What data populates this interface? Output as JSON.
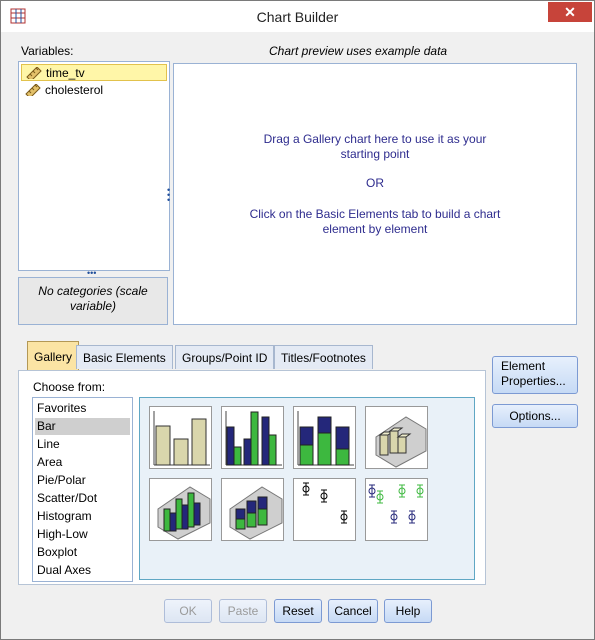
{
  "window": {
    "title": "Chart Builder",
    "close_label": "✕"
  },
  "variables": {
    "label": "Variables:",
    "items": [
      {
        "label": "time_tv",
        "icon": "scale-ruler-icon"
      },
      {
        "label": "cholesterol",
        "icon": "scale-ruler-icon"
      }
    ],
    "no_categories_line1": "No categories (scale",
    "no_categories_line2": "variable)"
  },
  "preview": {
    "caption": "Chart preview uses example data",
    "line1": "Drag a Gallery chart here to use it as your",
    "line2": "starting point",
    "or": "OR",
    "line3": "Click on the Basic Elements tab to build a chart",
    "line4": "element by element"
  },
  "tabs": [
    {
      "label": "Gallery",
      "active": true
    },
    {
      "label": "Basic Elements",
      "active": false
    },
    {
      "label": "Groups/Point ID",
      "active": false
    },
    {
      "label": "Titles/Footnotes",
      "active": false
    }
  ],
  "gallery": {
    "choose_label": "Choose from:",
    "types": [
      "Favorites",
      "Bar",
      "Line",
      "Area",
      "Pie/Polar",
      "Scatter/Dot",
      "Histogram",
      "High-Low",
      "Boxplot",
      "Dual Axes"
    ],
    "selected": "Bar",
    "thumbnails": [
      "simple-bar-thumbnail",
      "clustered-bar-thumbnail",
      "stacked-bar-thumbnail",
      "simple-3d-bar-thumbnail",
      "clustered-3d-bar-thumbnail",
      "stacked-3d-bar-thumbnail",
      "simple-error-bar-thumbnail",
      "clustered-error-bar-thumbnail"
    ]
  },
  "side_buttons": {
    "element_properties_line1": "Element",
    "element_properties_line2": "Properties...",
    "options": "Options..."
  },
  "bottom_buttons": {
    "ok": "OK",
    "paste": "Paste",
    "reset": "Reset",
    "cancel": "Cancel",
    "help": "Help"
  },
  "colors": {
    "bar_fill": "#d9d6ac",
    "green": "#3db83f",
    "navy": "#24277a",
    "preview_text": "#2e2c8e",
    "selected_var": "#fff6a8",
    "active_tab": "#fbe4a4"
  }
}
